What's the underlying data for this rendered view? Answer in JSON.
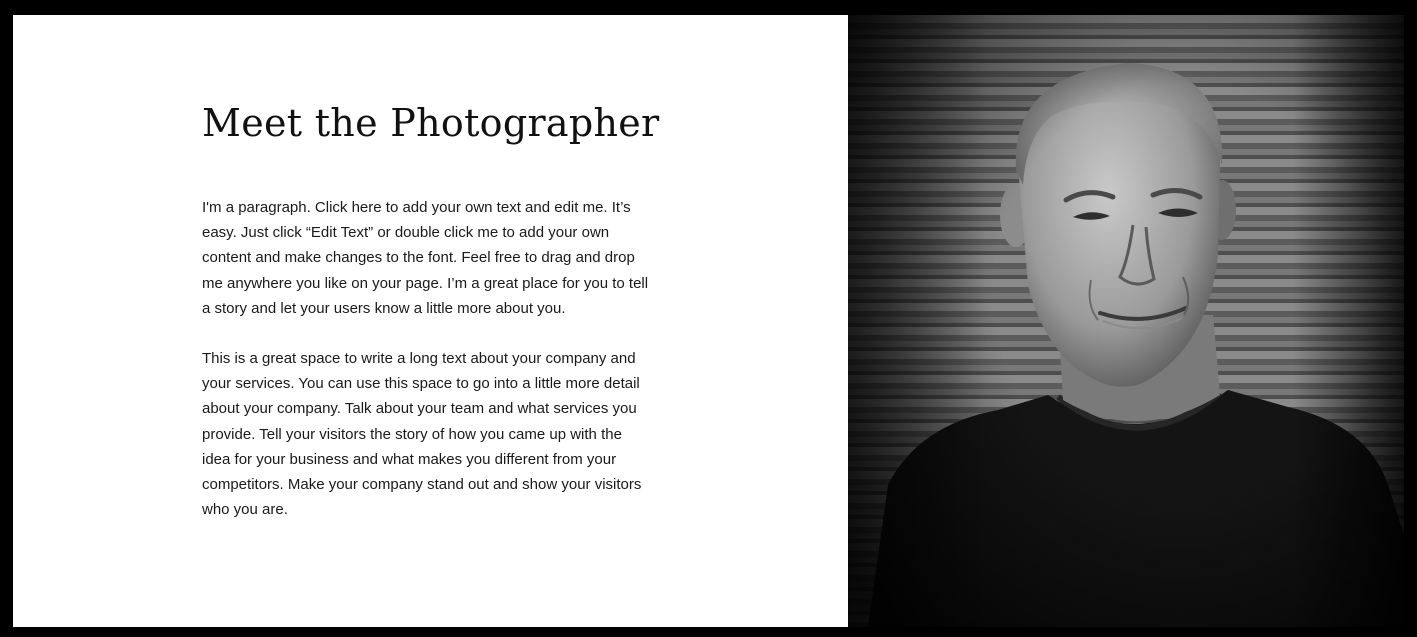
{
  "section": {
    "title": "Meet the Photographer",
    "paragraphs": [
      "I'm a paragraph. Click here to add your own text and edit me. It’s easy. Just click “Edit Text” or double click me to add your own content and make changes to the font. Feel free to drag and drop me anywhere you like on your page. I’m a great place for you to tell a story and let your users know a little more about you.",
      "This is a great space to write a long text about your company and your services. You can use this space to go into a little more detail about your company. Talk about your team and what services you provide. Tell your visitors the story of how you came up with the idea for your business and what makes you different from your competitors. Make your company stand out and show your visitors who you are."
    ]
  },
  "photo": {
    "subject": "portrait-photo",
    "style": "black-and-white"
  },
  "colors": {
    "page_border": "#000000",
    "panel_background": "#ffffff",
    "text": "#1a1a1a"
  }
}
